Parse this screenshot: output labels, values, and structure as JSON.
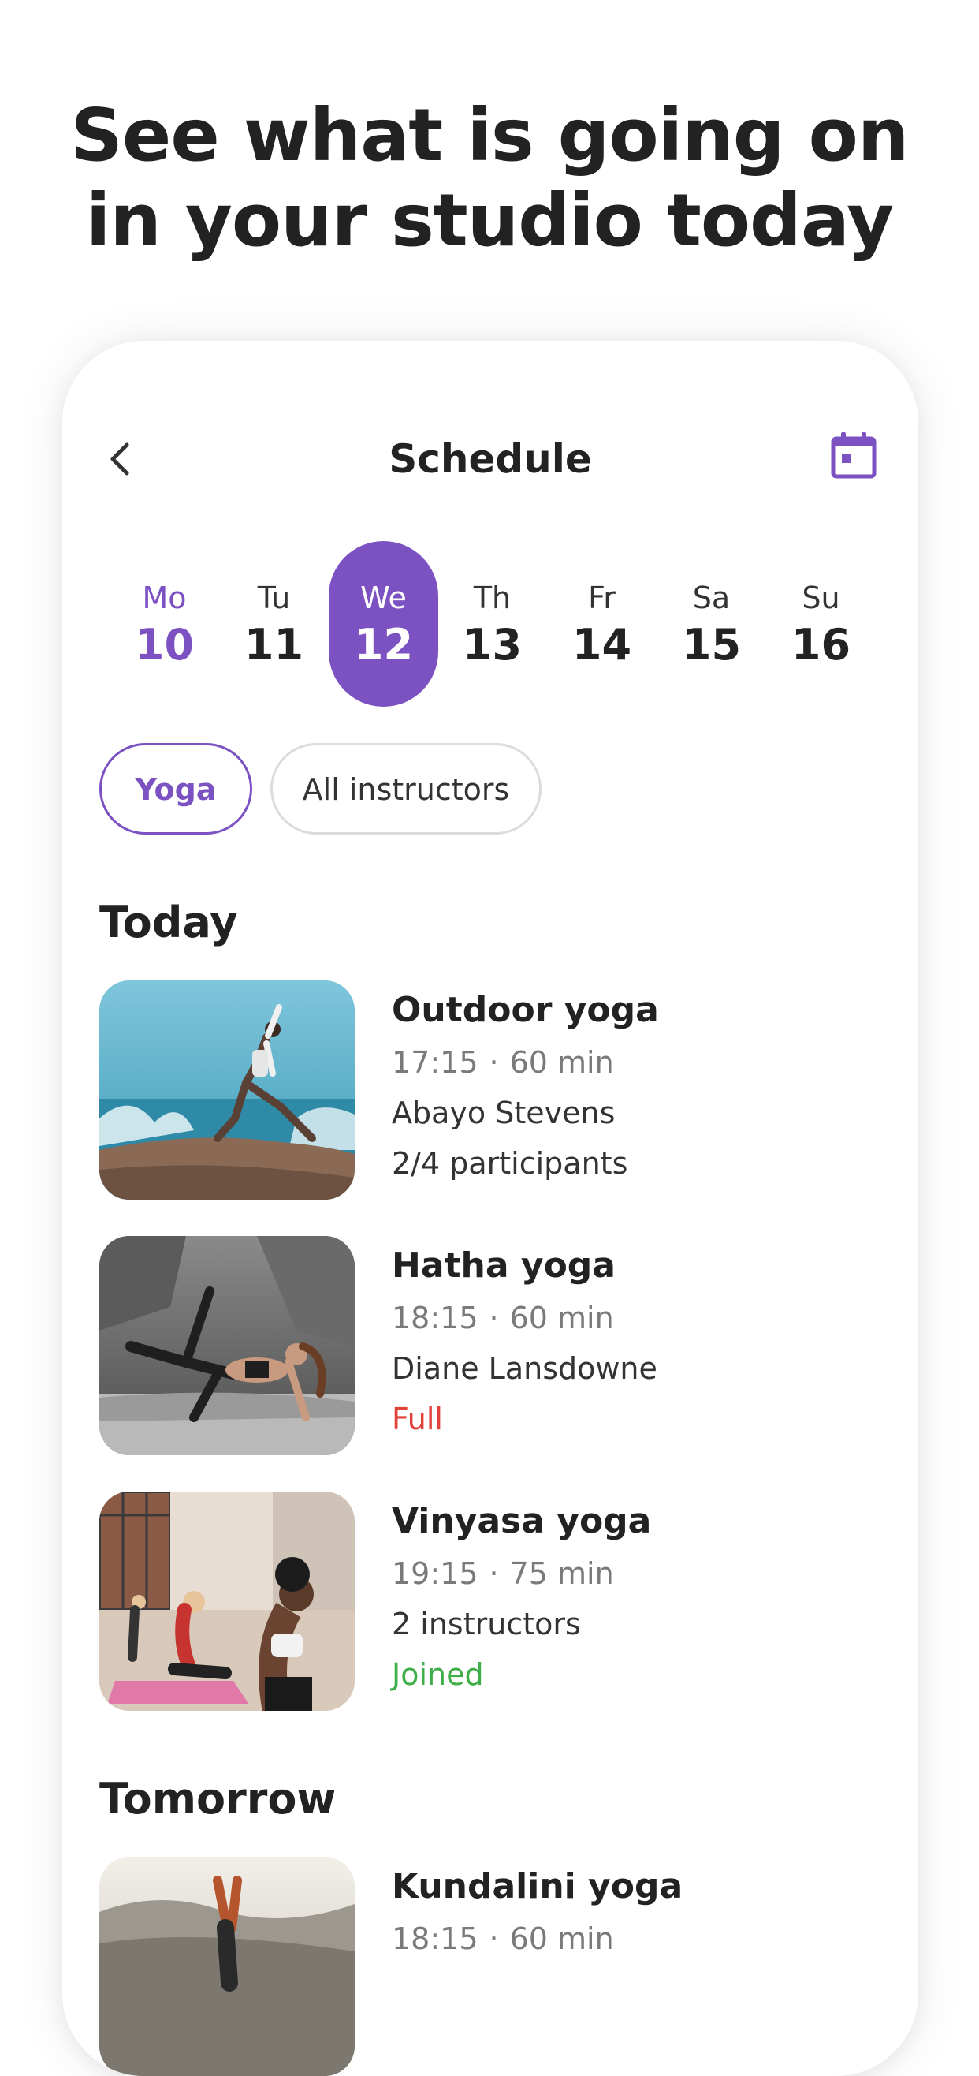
{
  "headline": {
    "line1": "See what is going on",
    "line2": "in your studio today"
  },
  "topbar": {
    "title": "Schedule",
    "back_icon": "chevron-left-icon",
    "calendar_icon": "calendar-icon"
  },
  "days": [
    {
      "name": "Mo",
      "num": "10",
      "state": "today"
    },
    {
      "name": "Tu",
      "num": "11",
      "state": ""
    },
    {
      "name": "We",
      "num": "12",
      "state": "selected"
    },
    {
      "name": "Th",
      "num": "13",
      "state": ""
    },
    {
      "name": "Fr",
      "num": "14",
      "state": ""
    },
    {
      "name": "Sa",
      "num": "15",
      "state": ""
    },
    {
      "name": "Su",
      "num": "16",
      "state": ""
    }
  ],
  "filters": {
    "activity": "Yoga",
    "instructors": "All instructors"
  },
  "sections": {
    "today": "Today",
    "tomorrow": "Tomorrow"
  },
  "classes": [
    {
      "name": "Outdoor yoga",
      "time": "17:15",
      "dot": "·",
      "duration": "60 min",
      "line1": "Abayo Stevens",
      "line2": "2/4 participants"
    },
    {
      "name": "Hatha yoga",
      "time": "18:15",
      "dot": "·",
      "duration": "60 min",
      "line1": "Diane Lansdowne",
      "line2": "Full"
    },
    {
      "name": "Vinyasa yoga",
      "time": "19:15",
      "dot": "·",
      "duration": "75 min",
      "line1": "2 instructors",
      "line2": "Joined"
    },
    {
      "name": "Kundalini yoga",
      "time": "18:15",
      "dot": "·",
      "duration": "60 min"
    }
  ],
  "colors": {
    "accent": "#7c52c3",
    "full": "#e0423b",
    "joined": "#3fae49"
  }
}
